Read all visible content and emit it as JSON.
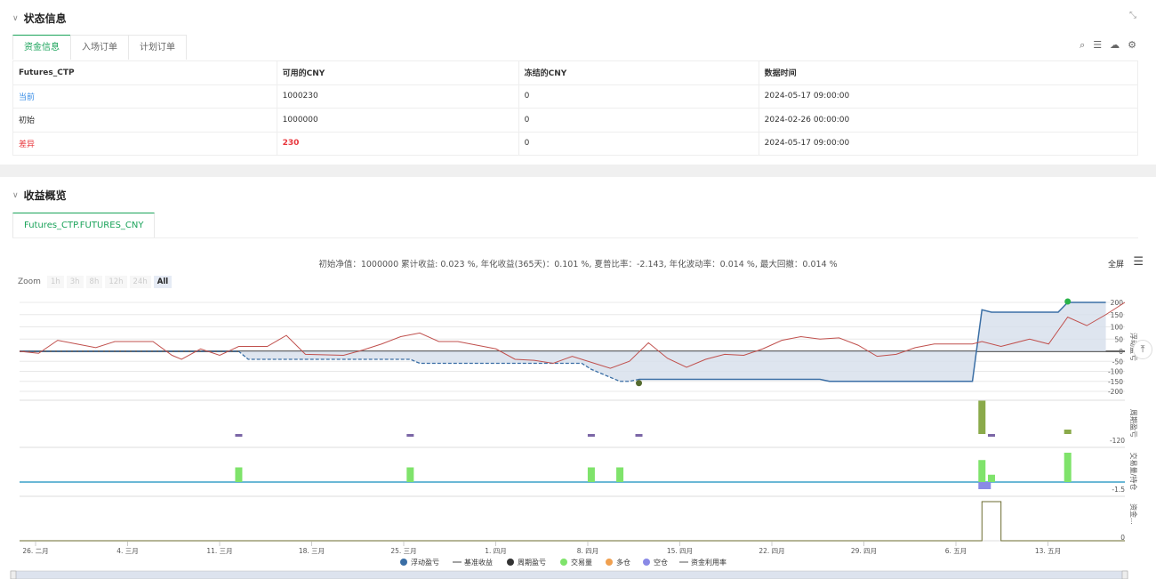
{
  "status": {
    "title": "状态信息",
    "tabs": [
      "资金信息",
      "入场订单",
      "计划订单"
    ],
    "table": {
      "headers": [
        "Futures_CTP",
        "可用的CNY",
        "冻结的CNY",
        "数据时间"
      ],
      "rows": [
        [
          "当前",
          "1000230",
          "0",
          "2024-05-17 09:00:00"
        ],
        [
          "初始",
          "1000000",
          "0",
          "2024-02-26 00:00:00"
        ],
        [
          "差异",
          "230",
          "0",
          "2024-05-17 09:00:00"
        ]
      ]
    }
  },
  "profit": {
    "title": "收益概览",
    "tab": "Futures_CTP.FUTURES_CNY",
    "stats": "初始净值：1000000 累计收益: 0.023 %, 年化收益(365天)：0.101 %, 夏普比率：-2.143, 年化波动率：0.014 %, 最大回撤：0.014 %",
    "fullscreen": "全屏",
    "zoom_label": "Zoom",
    "zoom_buttons": [
      "1h",
      "3h",
      "8h",
      "12h",
      "24h",
      "All"
    ],
    "legend": [
      "浮动盈亏",
      "基准收益",
      "周期盈亏",
      "交易量",
      "多仓",
      "空仓",
      "资金利用率"
    ]
  },
  "colors": {
    "accent": "#1aa35a",
    "blue": "#3a6ea5",
    "red": "#c0504d",
    "fill": "#d6dfeb",
    "green_bar": "#7fe36b"
  },
  "chart_data": {
    "type": "line",
    "x_ticks": [
      "26. 二月",
      "4. 三月",
      "11. 三月",
      "18. 三月",
      "25. 三月",
      "1. 四月",
      "8. 四月",
      "15. 四月",
      "22. 四月",
      "29. 四月",
      "6. 五月",
      "13. 五月"
    ],
    "y_ticks": [
      200,
      150,
      100,
      50,
      0,
      -50,
      -100,
      -150,
      -200
    ],
    "y_axis_label": "浮动盈亏",
    "panel2_axis_label": "周期盈亏",
    "panel2_tick": "-120",
    "panel3_axis_label": "交易量/持仓",
    "panel3_tick": "-1.5",
    "panel4_axis_label": "资金...",
    "panel4_tick": "0",
    "ylim": [
      -200,
      220
    ],
    "series": [
      {
        "name": "浮动盈亏",
        "points": [
          [
            0,
            0
          ],
          [
            23,
            0
          ],
          [
            24,
            -40
          ],
          [
            41,
            -40
          ],
          [
            42,
            -60
          ],
          [
            59,
            -60
          ],
          [
            60,
            -90
          ],
          [
            63,
            -150
          ],
          [
            64,
            -150
          ],
          [
            65,
            -140
          ],
          [
            84,
            -140
          ],
          [
            85,
            -150
          ],
          [
            100,
            -150
          ],
          [
            101,
            170
          ],
          [
            102,
            160
          ],
          [
            109,
            160
          ],
          [
            110,
            200
          ],
          [
            114,
            200
          ]
        ]
      },
      {
        "name": "基准收益",
        "points": [
          [
            0,
            0
          ],
          [
            2,
            -10
          ],
          [
            4,
            45
          ],
          [
            6,
            30
          ],
          [
            8,
            15
          ],
          [
            10,
            40
          ],
          [
            14,
            40
          ],
          [
            16,
            -20
          ],
          [
            17,
            -40
          ],
          [
            19,
            10
          ],
          [
            21,
            -20
          ],
          [
            23,
            20
          ],
          [
            26,
            20
          ],
          [
            28,
            65
          ],
          [
            30,
            -15
          ],
          [
            34,
            -20
          ],
          [
            36,
            5
          ],
          [
            38,
            30
          ],
          [
            40,
            60
          ],
          [
            42,
            75
          ],
          [
            44,
            40
          ],
          [
            46,
            40
          ],
          [
            50,
            10
          ],
          [
            52,
            -40
          ],
          [
            54,
            -45
          ],
          [
            56,
            -60
          ],
          [
            58,
            -25
          ],
          [
            60,
            -55
          ],
          [
            62,
            -85
          ],
          [
            64,
            -50
          ],
          [
            66,
            35
          ],
          [
            68,
            -35
          ],
          [
            70,
            -80
          ],
          [
            72,
            -40
          ],
          [
            74,
            -15
          ],
          [
            76,
            -20
          ],
          [
            78,
            10
          ],
          [
            80,
            45
          ],
          [
            82,
            60
          ],
          [
            84,
            50
          ],
          [
            86,
            55
          ],
          [
            88,
            25
          ],
          [
            90,
            -25
          ],
          [
            92,
            -15
          ],
          [
            94,
            15
          ],
          [
            96,
            30
          ],
          [
            100,
            30
          ],
          [
            101,
            40
          ],
          [
            103,
            20
          ],
          [
            106,
            50
          ],
          [
            108,
            30
          ],
          [
            110,
            140
          ],
          [
            112,
            105
          ],
          [
            114,
            150
          ],
          [
            116,
            200
          ]
        ]
      }
    ],
    "period_pnl_bars": [
      [
        23,
        -15
      ],
      [
        41,
        -15
      ],
      [
        60,
        -15
      ],
      [
        65,
        -15
      ],
      [
        101,
        150
      ],
      [
        102,
        -10
      ],
      [
        110,
        20
      ]
    ],
    "volume_bars": [
      [
        23,
        30
      ],
      [
        41,
        30
      ],
      [
        60,
        30
      ],
      [
        63,
        30
      ],
      [
        101,
        45
      ],
      [
        102,
        15
      ],
      [
        110,
        60
      ]
    ],
    "short_bars": [
      [
        101,
        -15
      ]
    ],
    "utilization": [
      [
        0,
        0
      ],
      [
        101,
        0
      ],
      [
        101,
        1
      ],
      [
        103,
        1
      ],
      [
        103,
        0
      ],
      [
        116,
        0
      ]
    ]
  }
}
